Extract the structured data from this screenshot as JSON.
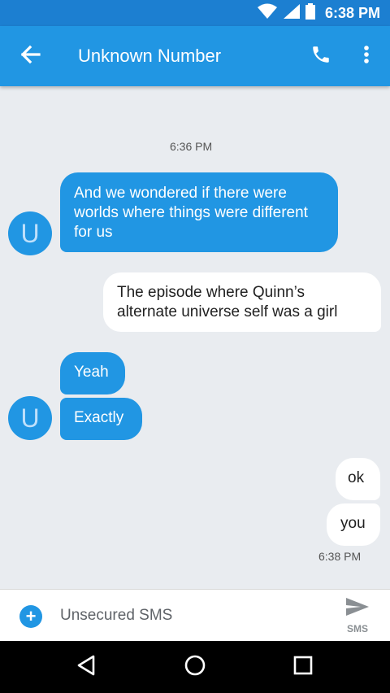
{
  "status_bar": {
    "time": "6:38 PM"
  },
  "app_bar": {
    "title": "Unknown Number"
  },
  "thread": {
    "timestamp_top": "6:36 PM",
    "messages": [
      {
        "direction": "in",
        "text": "And we wondered if there were worlds where things were different for us"
      },
      {
        "direction": "out",
        "text": "The episode where Quinn’s alternate universe self was a girl"
      },
      {
        "direction": "in",
        "text": "Yeah"
      },
      {
        "direction": "in",
        "text": "Exactly"
      },
      {
        "direction": "out",
        "text": "ok"
      },
      {
        "direction": "out",
        "text": "you"
      }
    ],
    "avatar_letter": "U",
    "timestamp_bottom": "6:38 PM"
  },
  "compose": {
    "placeholder": "Unsecured SMS",
    "send_label": "SMS"
  },
  "colors": {
    "accent": "#2196e3",
    "status_bar": "#1c7fd1",
    "background": "#e9ecf0"
  },
  "icons": {
    "back": "arrow-left-icon",
    "call": "phone-icon",
    "menu": "more-vert-icon",
    "add": "add-circle-icon",
    "send": "send-icon"
  }
}
